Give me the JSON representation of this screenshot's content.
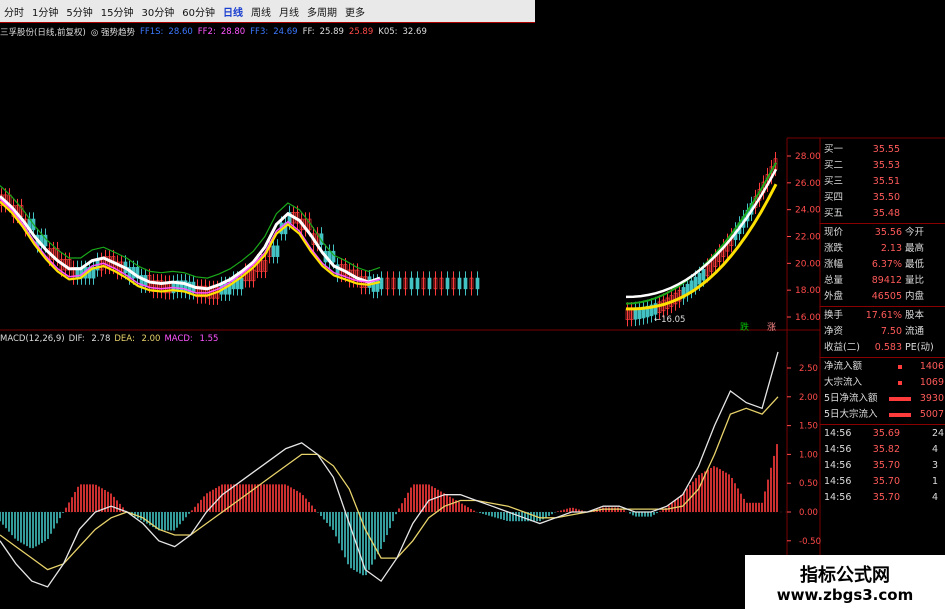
{
  "colors": {
    "up": "#ff3b3b",
    "down": "#42c2c2",
    "white_ma": "#ffffff",
    "yellow_ma": "#ffe100",
    "green_ma": "#1aa81a",
    "pink_ma": "#ff55ff",
    "dif": "#e6e6e6",
    "dea": "#e8d36b",
    "grid": "#7a0000",
    "axis_text": "#ff4a4a",
    "panel_red": "#ff5a5a"
  },
  "toolbar": {
    "items": [
      "分时",
      "1分钟",
      "5分钟",
      "15分钟",
      "30分钟",
      "60分钟",
      "日线",
      "周线",
      "月线",
      "多周期",
      "更多"
    ],
    "active": "日线"
  },
  "indicator_line": {
    "title": "三孚股份(日线,前复权)",
    "indicator": "◎ 强势趋势",
    "values": [
      {
        "label": "FF1S:",
        "value": "28.60"
      },
      {
        "label": "FF2:",
        "value": "28.80"
      },
      {
        "label": "FF3:",
        "value": "24.69"
      },
      {
        "label": "FF:",
        "value": "25.89"
      },
      {
        "label": "",
        "value": "25.89"
      },
      {
        "label": "K05:",
        "value": "32.69"
      }
    ]
  },
  "macd_line": {
    "label": "MACD(12,26,9)",
    "dif_label": "DIF:",
    "dif": "2.78",
    "dea_label": "DEA:",
    "dea": "2.00",
    "macd_label": "MACD:",
    "macd": "1.55"
  },
  "price_axis": [
    "28.00",
    "26.00",
    "24.00",
    "22.00",
    "20.00",
    "18.00",
    "16.00"
  ],
  "macd_axis": [
    "2.50",
    "2.00",
    "1.50",
    "1.00",
    "0.50",
    "0.00",
    "-0.50",
    "-1.00"
  ],
  "low_label": "16.05",
  "tags": [
    "跌",
    "涨"
  ],
  "panel": {
    "bids": [
      {
        "label": "买一",
        "value": "35.55"
      },
      {
        "label": "买二",
        "value": "35.53"
      },
      {
        "label": "买三",
        "value": "35.51"
      },
      {
        "label": "买四",
        "value": "35.50"
      },
      {
        "label": "买五",
        "value": "35.48"
      }
    ],
    "stats": [
      {
        "label": "现价",
        "value": "35.56",
        "label2": "今开"
      },
      {
        "label": "涨跌",
        "value": "2.13",
        "label2": "最高"
      },
      {
        "label": "涨幅",
        "value": "6.37%",
        "label2": "最低"
      },
      {
        "label": "总量",
        "value": "89412",
        "label2": "量比"
      },
      {
        "label": "外盘",
        "value": "46505",
        "label2": "内盘"
      }
    ],
    "stats2": [
      {
        "label": "换手",
        "value": "17.61%",
        "label2": "股本"
      },
      {
        "label": "净资",
        "value": "7.50",
        "label2": "流通"
      },
      {
        "label": "收益(二)",
        "value": "0.583",
        "label2": "PE(动)"
      }
    ],
    "flows": [
      {
        "label": "净流入额",
        "value": "1406"
      },
      {
        "label": "大宗流入",
        "value": "1069"
      },
      {
        "label": "5日净流入额",
        "value": "3930"
      },
      {
        "label": "5日大宗流入",
        "value": "5007"
      }
    ],
    "ticks": [
      {
        "time": "14:56",
        "price": "35.69",
        "vol": "24"
      },
      {
        "time": "14:56",
        "price": "35.82",
        "vol": "4"
      },
      {
        "time": "14:56",
        "price": "35.70",
        "vol": "3"
      },
      {
        "time": "14:56",
        "price": "35.70",
        "vol": "1"
      },
      {
        "time": "14:56",
        "price": "35.70",
        "vol": "4"
      }
    ]
  },
  "watermark": {
    "line1": "指标公式网",
    "line2": "www.zbgs3.com"
  },
  "chart_data": [
    {
      "type": "line",
      "title": "三孚股份(日线,前复权)",
      "ylim": [
        15,
        30
      ],
      "series": [
        {
          "name": "FF1S",
          "values": [
            25.0,
            24.2,
            23.2,
            22.0,
            21.0,
            20.2,
            19.6,
            19.6,
            20.2,
            20.4,
            20.0,
            19.6,
            19.0,
            18.6,
            18.5,
            18.6,
            18.5,
            18.2,
            18.1,
            18.4,
            18.8,
            19.4,
            20.1,
            21.2,
            22.9,
            23.7,
            23.2,
            22.1,
            20.8,
            19.8,
            19.4,
            18.9,
            18.6,
            18.9
          ]
        },
        {
          "name": "FF2",
          "values": [
            24.8,
            24.0,
            22.9,
            21.6,
            20.5,
            19.6,
            19.0,
            19.1,
            19.8,
            20.0,
            19.6,
            19.1,
            18.5,
            18.2,
            18.1,
            18.2,
            18.1,
            17.8,
            17.8,
            18.1,
            18.6,
            19.2,
            19.9,
            20.8,
            22.4,
            23.1,
            22.4,
            21.1,
            20.0,
            19.3,
            19.0,
            18.7,
            18.6,
            18.8
          ]
        }
      ]
    },
    {
      "type": "line",
      "title": "MACD(12,26,9)",
      "ylim": [
        -1.5,
        3.0
      ],
      "series": [
        {
          "name": "DIF",
          "values": [
            -0.5,
            -0.9,
            -1.2,
            -1.3,
            -0.9,
            -0.3,
            0.0,
            0.1,
            0.0,
            -0.2,
            -0.5,
            -0.6,
            -0.4,
            0.0,
            0.3,
            0.5,
            0.7,
            0.9,
            1.1,
            1.2,
            1.0,
            0.6,
            -0.2,
            -1.0,
            -1.2,
            -0.8,
            -0.2,
            0.2,
            0.3,
            0.3,
            0.2,
            0.1,
            0.0,
            -0.1,
            -0.2,
            -0.1,
            0.0,
            0.0,
            0.1,
            0.1,
            0.0,
            0.0,
            0.1,
            0.3,
            0.8,
            1.5,
            2.1,
            1.9,
            1.8,
            2.78
          ]
        },
        {
          "name": "DEA",
          "values": [
            -0.4,
            -0.6,
            -0.8,
            -1.0,
            -0.9,
            -0.6,
            -0.3,
            -0.1,
            0.0,
            -0.1,
            -0.3,
            -0.4,
            -0.4,
            -0.2,
            0.0,
            0.2,
            0.4,
            0.6,
            0.8,
            1.0,
            1.0,
            0.8,
            0.4,
            -0.3,
            -0.8,
            -0.8,
            -0.5,
            -0.1,
            0.1,
            0.2,
            0.2,
            0.15,
            0.1,
            0.0,
            -0.1,
            -0.1,
            -0.05,
            0.0,
            0.05,
            0.05,
            0.05,
            0.05,
            0.05,
            0.1,
            0.4,
            1.0,
            1.7,
            1.8,
            1.7,
            2.0
          ]
        }
      ]
    }
  ]
}
